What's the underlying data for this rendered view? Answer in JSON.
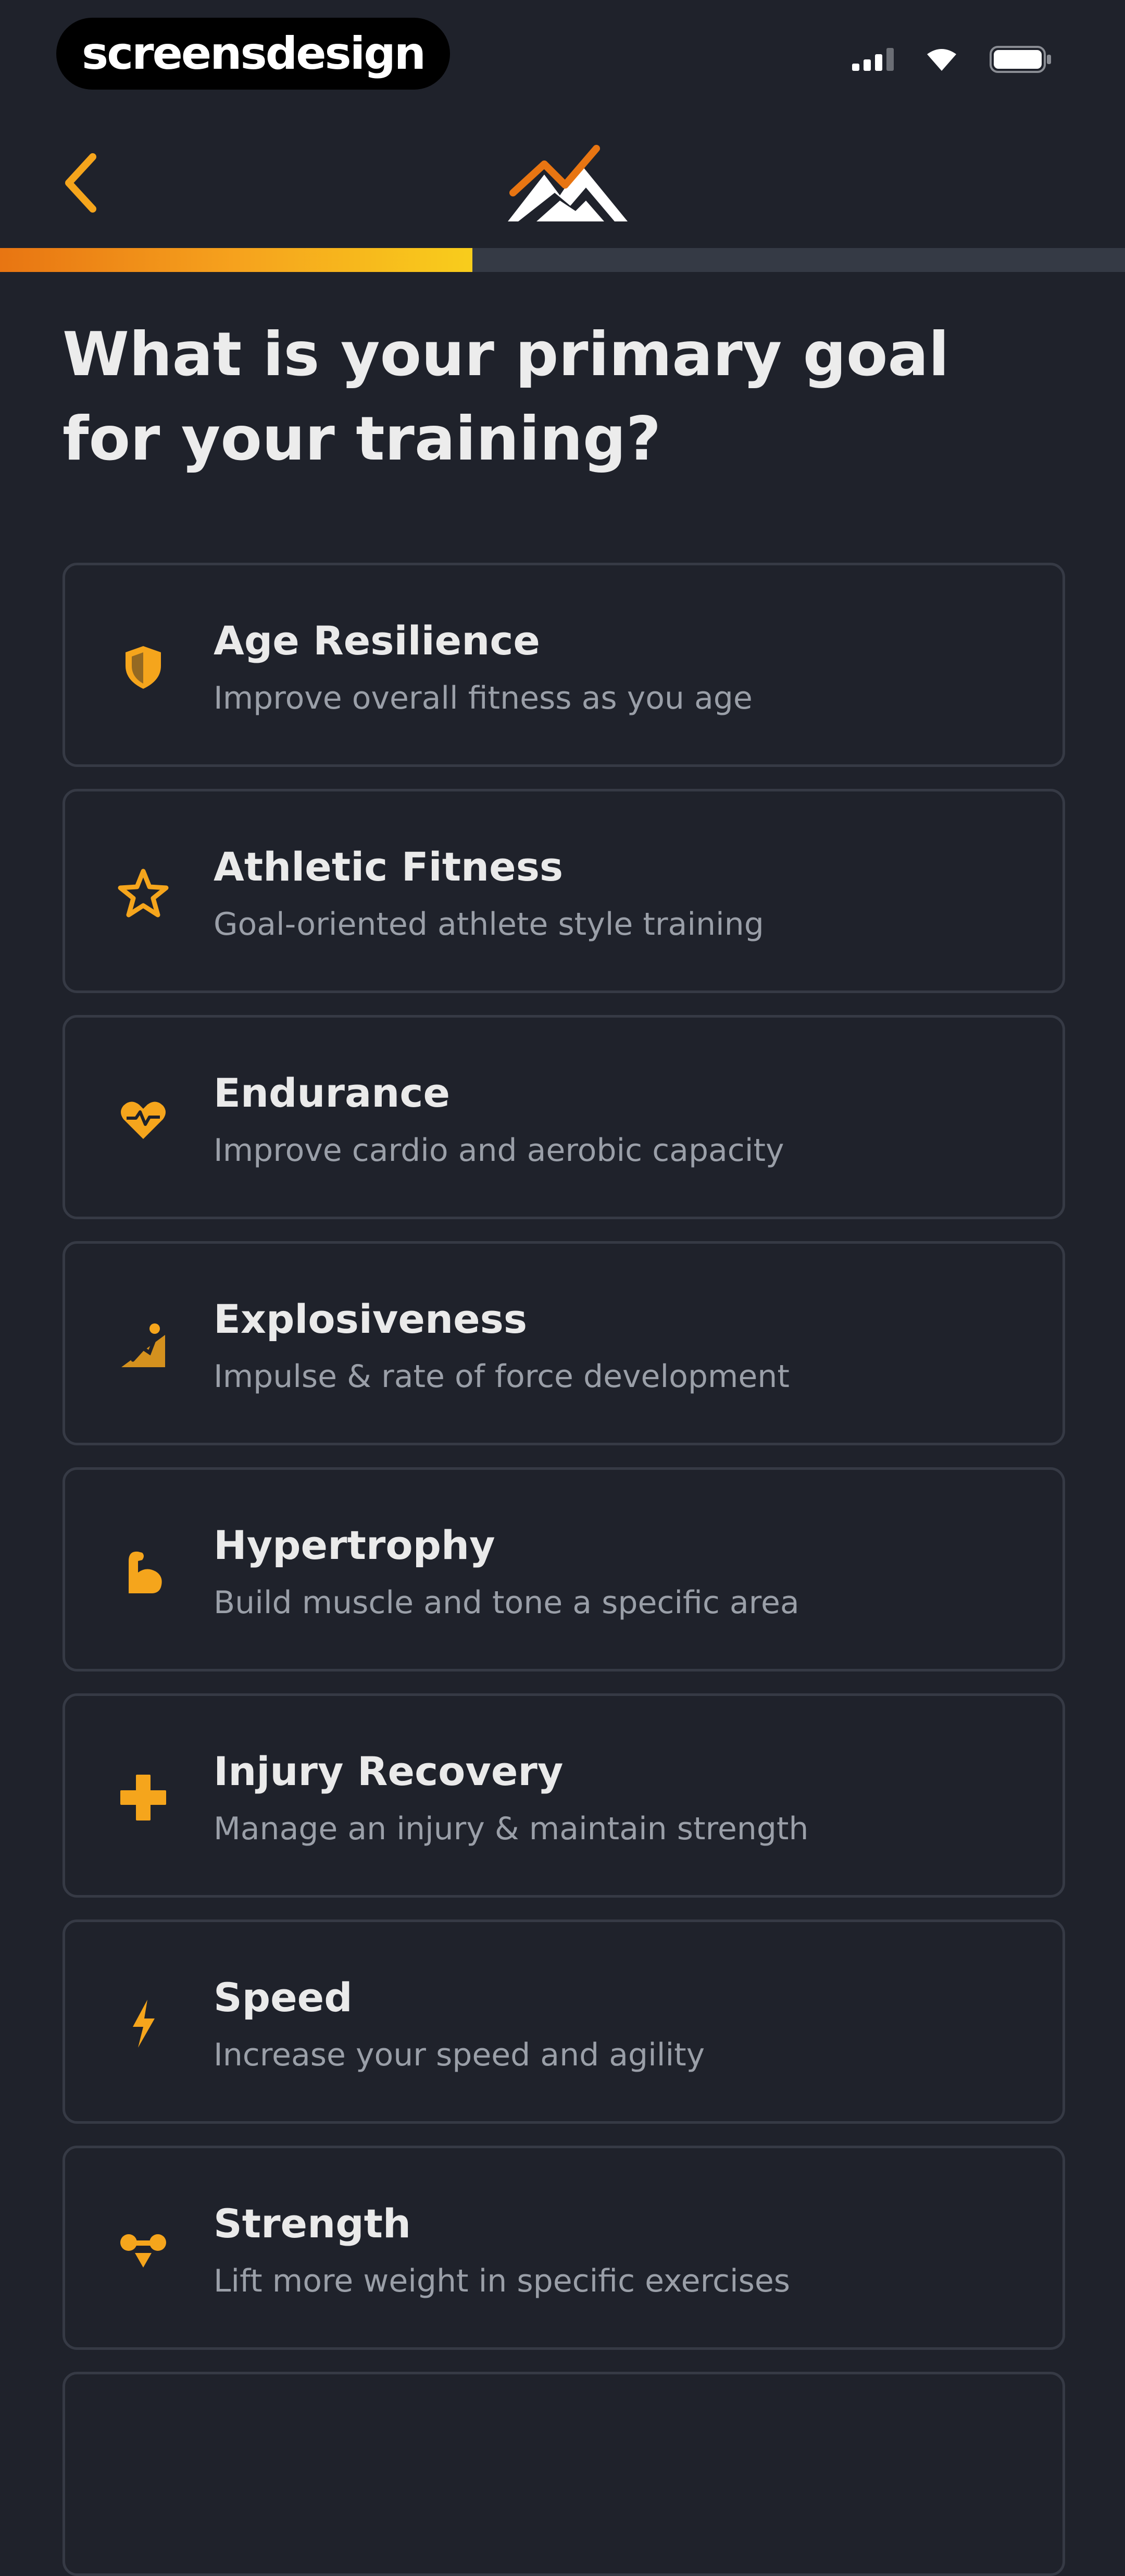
{
  "status_bar": {
    "brand": "screensdesign",
    "icons": [
      "signal-icon",
      "wifi-icon",
      "battery-icon"
    ]
  },
  "nav": {
    "back_icon": "chevron-left-icon",
    "logo_icon": "mountain-logo-icon"
  },
  "progress": {
    "value": 0.42
  },
  "question": "What is your primary goal for your training?",
  "options": [
    {
      "title": "Age Resilience",
      "subtitle": "Improve overall fitness as you age",
      "icon": "shield-icon"
    },
    {
      "title": "Athletic Fitness",
      "subtitle": "Goal-oriented athlete style training",
      "icon": "star-icon"
    },
    {
      "title": "Endurance",
      "subtitle": "Improve cardio and aerobic capacity",
      "icon": "heart-icon"
    },
    {
      "title": "Explosiveness",
      "subtitle": "Impulse & rate of force development",
      "icon": "runner-icon"
    },
    {
      "title": "Hypertrophy",
      "subtitle": "Build muscle and tone a specific area",
      "icon": "flexed-arm-icon"
    },
    {
      "title": "Injury Recovery",
      "subtitle": "Manage an injury & maintain strength",
      "icon": "plus-icon"
    },
    {
      "title": "Speed",
      "subtitle": "Increase your speed and agility",
      "icon": "lightning-icon"
    },
    {
      "title": "Strength",
      "subtitle": "Lift more weight in specific exercises",
      "icon": "dumbbell-icon"
    },
    {
      "title": "",
      "subtitle": "",
      "icon": ""
    }
  ],
  "colors": {
    "background": "#1f222b",
    "accent": "#f5a51c",
    "accent_dark": "#e87512",
    "card_border": "#363a45",
    "title_text": "#eaeaea",
    "subtitle_text": "#9a9fa8"
  }
}
